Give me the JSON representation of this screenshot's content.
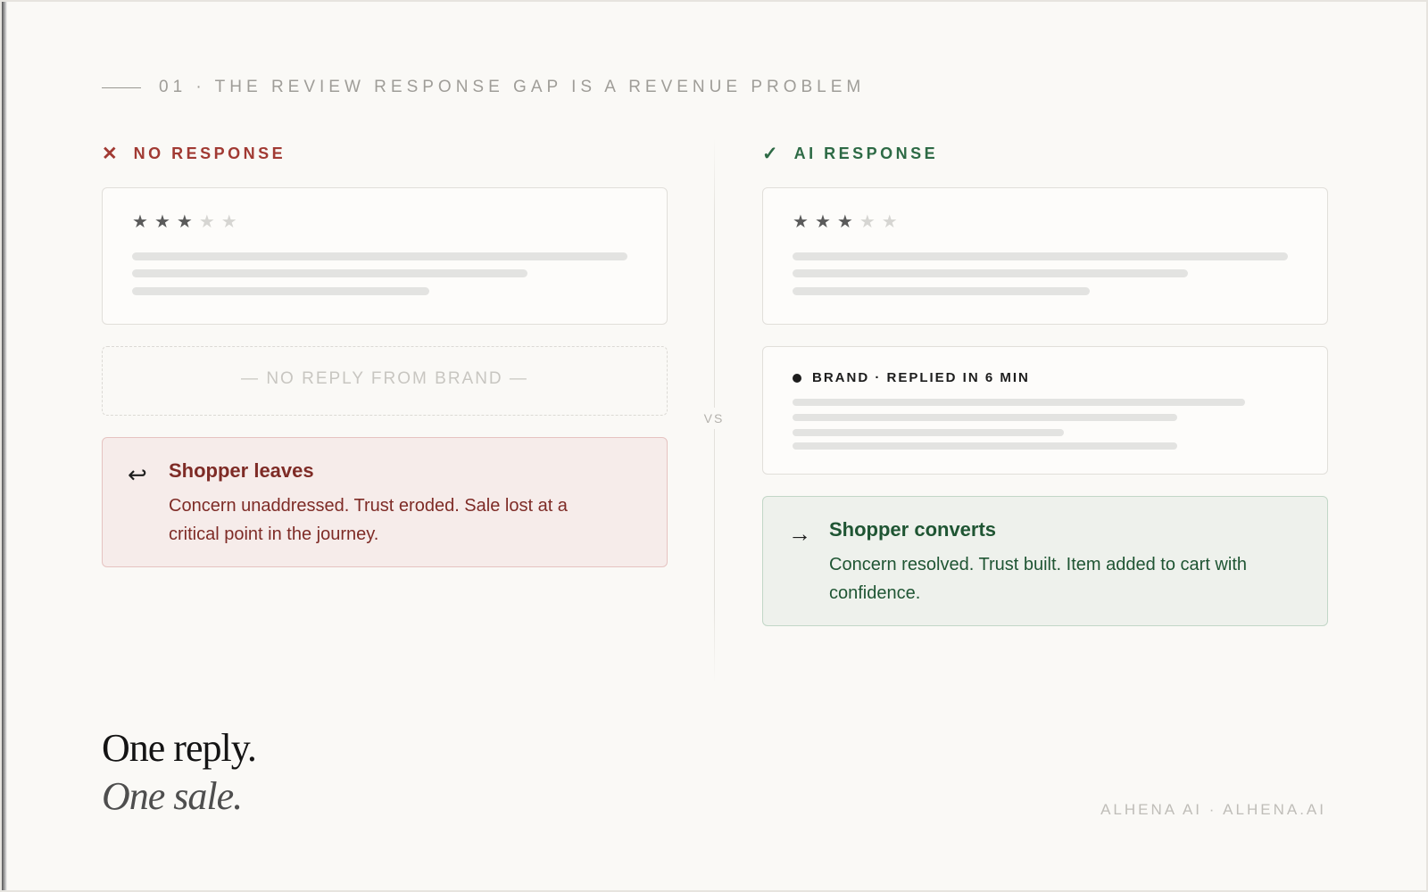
{
  "section_header": {
    "text": "01 · THE REVIEW RESPONSE GAP IS A REVENUE PROBLEM"
  },
  "left": {
    "mark": "✕",
    "label": "NO RESPONSE",
    "review": {
      "stars_filled": 3,
      "stars_total": 5
    },
    "reply": {
      "text": "— NO REPLY FROM BRAND —"
    },
    "outcome": {
      "arrow": "↩",
      "title": "Shopper leaves",
      "description": "Concern unaddressed. Trust eroded. Sale lost at a critical point in the journey."
    }
  },
  "vs_label": "VS",
  "right": {
    "mark": "✓",
    "label": "AI RESPONSE",
    "review": {
      "stars_filled": 3,
      "stars_total": 5
    },
    "reply": {
      "header": "BRAND · REPLIED IN 6 MIN"
    },
    "outcome": {
      "arrow": "→",
      "title": "Shopper converts",
      "description": "Concern resolved. Trust built. Item added to cart with confidence."
    }
  },
  "tagline": {
    "line1": "One reply.",
    "line2": "One sale."
  },
  "footer": {
    "text": "ALHENA AI · ALHENA.AI"
  },
  "colors": {
    "negative": "#a13a33",
    "positive": "#2d6a45",
    "background": "#faf9f6"
  }
}
